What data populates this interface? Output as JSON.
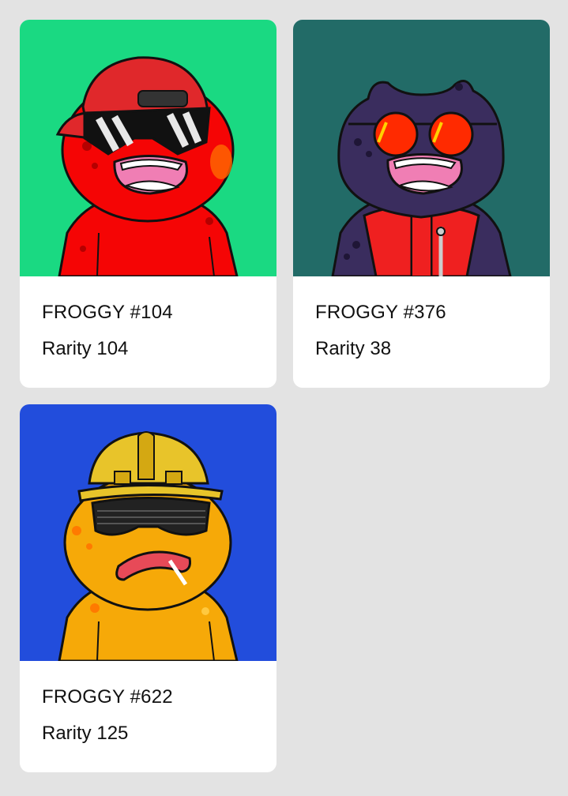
{
  "cards": [
    {
      "name": "FROGGY #104",
      "rarity": "Rarity 104",
      "art": {
        "background": "#1ad982",
        "body": "#f50505",
        "accessory": "red-cap",
        "eyewear": "white-shutter-shades"
      }
    },
    {
      "name": "FROGGY #376",
      "rarity": "Rarity 38",
      "art": {
        "background": "#226b67",
        "body": "#3a2d5e",
        "accessory": "red-puffer-vest",
        "eyewear": "red-round-sunglasses"
      }
    },
    {
      "name": "FROGGY #622",
      "rarity": "Rarity 125",
      "art": {
        "background": "#224ddc",
        "body": "#f6a908",
        "accessory": "yellow-hard-hat",
        "eyewear": "black-shutter-shades"
      }
    }
  ]
}
